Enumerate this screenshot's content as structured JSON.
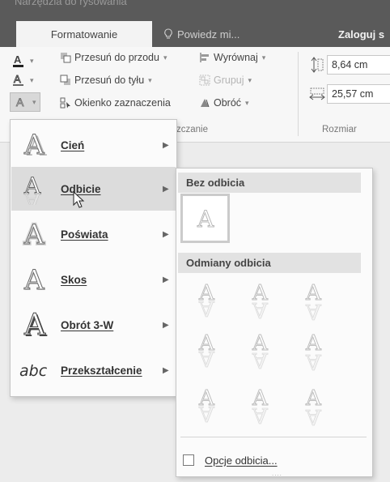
{
  "ribbon": {
    "context_label": "Narzędzia do rysowania",
    "tab_format": "Formatowanie",
    "tell_me": "Powiedz mi...",
    "sign_in": "Zaloguj s"
  },
  "arrange": {
    "bring_forward": "Przesuń do przodu",
    "send_backward": "Przesuń do tyłu",
    "selection_pane": "Okienko zaznaczenia",
    "align": "Wyrównaj",
    "group": "Grupuj",
    "rotate": "Obróć",
    "group_label": "zczanie"
  },
  "size": {
    "height": "8,64  cm",
    "width": "25,57  cm",
    "group_label": "Rozmiar"
  },
  "text_effects_menu": {
    "items": [
      {
        "label": "Cień",
        "icon": "shadow-a-icon"
      },
      {
        "label": "Odbicie",
        "icon": "reflection-a-icon"
      },
      {
        "label": "Poświata",
        "icon": "glow-a-icon"
      },
      {
        "label": "Skos",
        "icon": "bevel-a-icon"
      },
      {
        "label": "Obrót 3-W",
        "icon": "3d-rotation-a-icon"
      },
      {
        "label": "Przekształcenie",
        "icon": "transform-abc-icon"
      }
    ],
    "hovered": "Odbicie"
  },
  "reflection_submenu": {
    "no_reflection_header": "Bez odbicia",
    "variants_header": "Odmiany odbicia",
    "options_label": "Opcje odbicia...",
    "grip": "....",
    "variant_count": 9
  },
  "colors": {
    "ribbon_dark": "#5a5a5a",
    "menu_bg": "#fbfbfb",
    "hover_bg": "#dcdcdc",
    "header_bg": "#e2e2e2"
  }
}
